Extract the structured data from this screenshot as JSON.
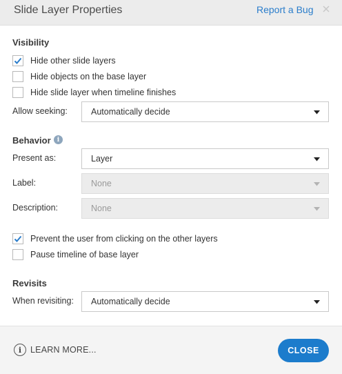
{
  "window": {
    "title": "Slide Layer Properties",
    "report_bug": "Report a Bug",
    "close_icon": "close-icon"
  },
  "visibility": {
    "heading": "Visibility",
    "hide_other_layers": {
      "label": "Hide other slide layers",
      "checked": true
    },
    "hide_base_objects": {
      "label": "Hide objects on the base layer",
      "checked": false
    },
    "hide_when_finishes": {
      "label": "Hide slide layer when timeline finishes",
      "checked": false
    },
    "allow_seeking": {
      "label": "Allow seeking:",
      "value": "Automatically decide"
    }
  },
  "behavior": {
    "heading": "Behavior",
    "info_icon": "info-icon",
    "present_as": {
      "label": "Present as:",
      "value": "Layer"
    },
    "label_field": {
      "label": "Label:",
      "value": "None",
      "disabled": true
    },
    "description": {
      "label": "Description:",
      "value": "None",
      "disabled": true
    },
    "prevent_clicking": {
      "label": "Prevent the user from clicking on the other layers",
      "checked": true
    },
    "pause_base": {
      "label": "Pause timeline of base layer",
      "checked": false
    }
  },
  "revisits": {
    "heading": "Revisits",
    "when_revisiting": {
      "label": "When revisiting:",
      "value": "Automatically decide"
    }
  },
  "footer": {
    "learn_more": "LEARN MORE...",
    "close": "CLOSE"
  },
  "colors": {
    "accent": "#1c7ccc",
    "link": "#2a7dcb",
    "checkmark": "#2a7dcb"
  }
}
